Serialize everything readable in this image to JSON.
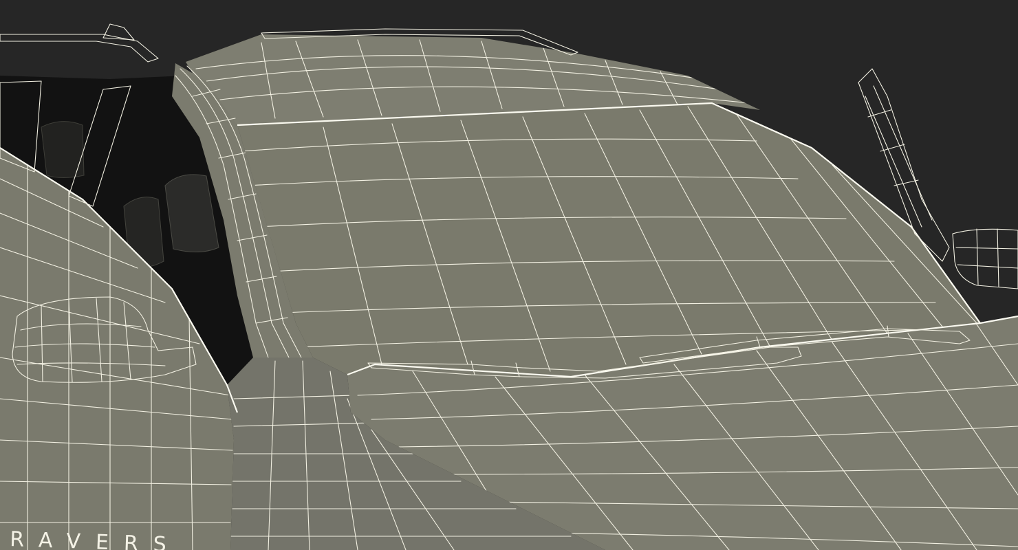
{
  "badge": {
    "text": "RAVERS"
  },
  "colors": {
    "background": "#262626",
    "body": "#7b7b6e",
    "body_shadow": "#6c6c60",
    "glass": "#777769",
    "interior": "#121212",
    "wire": "#f2f0e2"
  }
}
